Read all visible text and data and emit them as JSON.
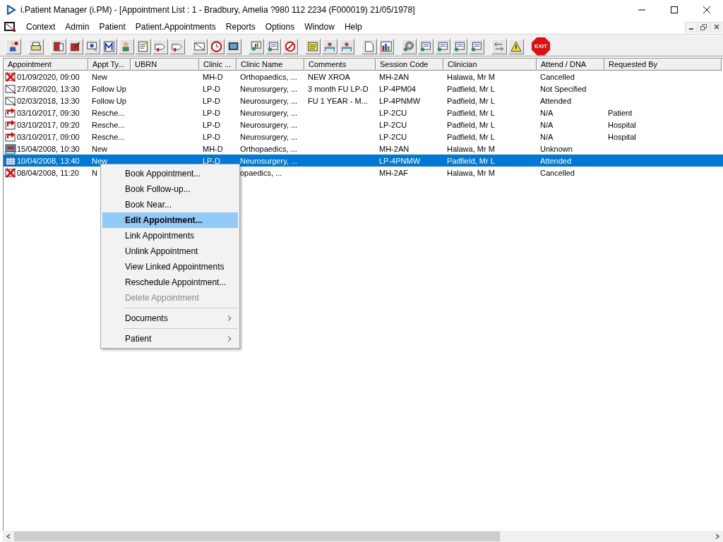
{
  "window": {
    "title": "i.Patient Manager (i.PM) - [Appointment List : 1 - Bradbury, Amelia ?980 112 2234 (F000019) 21/05/1978]"
  },
  "menu_bar": [
    "Context",
    "Admin",
    "Patient",
    "Patient.Appointments",
    "Reports",
    "Options",
    "Window",
    "Help"
  ],
  "toolbar": {
    "exit_label": "EXIT"
  },
  "table": {
    "columns": [
      "Appointment",
      "Appt Ty...",
      "UBRN",
      "Clinic ...",
      "Clinic Name",
      "Comments",
      "Session Code",
      "Clinician",
      "Attend / DNA",
      "Requested By"
    ],
    "rows": [
      {
        "kind": "cancelled",
        "selected": false,
        "cells": [
          "01/09/2020, 09:00",
          "New",
          "",
          "MH-D",
          "Orthopaedics, ...",
          "NEW XROA",
          "MH-2AN",
          "Halawa, Mr M",
          "Cancelled",
          ""
        ]
      },
      {
        "kind": "letter",
        "selected": false,
        "cells": [
          "27/08/2020, 13:30",
          "Follow Up",
          "",
          "LP-D",
          "Neurosurgery, ...",
          "3 month FU LP-D",
          "LP-4PM04",
          "Padfield, Mr L",
          "Not Specified",
          ""
        ]
      },
      {
        "kind": "letter",
        "selected": false,
        "cells": [
          "02/03/2018, 13:30",
          "Follow Up",
          "",
          "LP-D",
          "Neurosurgery, ...",
          "FU 1 YEAR - M...",
          "LP-4PNMW",
          "Padfield, Mr L",
          "Attended",
          ""
        ]
      },
      {
        "kind": "rescheduled",
        "selected": false,
        "cells": [
          "03/10/2017, 09:30",
          "Resche...",
          "",
          "LP-D",
          "Neurosurgery, ...",
          "",
          "LP-2CU",
          "Padfield, Mr L",
          "N/A",
          "Patient"
        ]
      },
      {
        "kind": "rescheduled",
        "selected": false,
        "cells": [
          "03/10/2017, 09:20",
          "Resche...",
          "",
          "LP-D",
          "Neurosurgery, ...",
          "",
          "LP-2CU",
          "Padfield, Mr L",
          "N/A",
          "Hospital"
        ]
      },
      {
        "kind": "rescheduled",
        "selected": false,
        "cells": [
          "03/10/2017, 09:00",
          "Resche...",
          "",
          "LP-D",
          "Neurosurgery, ...",
          "",
          "LP-2CU",
          "Padfield, Mr L",
          "N/A",
          "Hospital"
        ]
      },
      {
        "kind": "dna",
        "selected": false,
        "cells": [
          "15/04/2008, 10:30",
          "New",
          "",
          "MH-D",
          "Orthopaedics, ...",
          "",
          "MH-2AN",
          "Halawa, Mr M",
          "Unknown",
          ""
        ]
      },
      {
        "kind": "attended",
        "selected": true,
        "cells": [
          "10/04/2008, 13:40",
          "New",
          "",
          "LP-D",
          "Neurosurgery, ...",
          "",
          "LP-4PNMW",
          "Padfield, Mr L",
          "Attended",
          ""
        ]
      },
      {
        "kind": "cancelled",
        "selected": false,
        "cells": [
          "08/04/2008, 11:20",
          "N",
          "",
          "",
          "opaedics, ...",
          "",
          "MH-2AF",
          "Halawa, Mr M",
          "Cancelled",
          ""
        ]
      }
    ]
  },
  "context_menu": {
    "groups": [
      [
        {
          "label": "Book Appointment...",
          "selected": false,
          "disabled": false,
          "submenu": false
        },
        {
          "label": "Book Follow-up...",
          "selected": false,
          "disabled": false,
          "submenu": false
        },
        {
          "label": "Book Near...",
          "selected": false,
          "disabled": false,
          "submenu": false
        },
        {
          "label": "Edit Appointment...",
          "selected": true,
          "disabled": false,
          "submenu": false
        },
        {
          "label": "Link Appointments",
          "selected": false,
          "disabled": false,
          "submenu": false
        },
        {
          "label": "Unlink Appointment",
          "selected": false,
          "disabled": false,
          "submenu": false
        },
        {
          "label": "View Linked Appointments",
          "selected": false,
          "disabled": false,
          "submenu": false
        },
        {
          "label": "Reschedule Appointment...",
          "selected": false,
          "disabled": false,
          "submenu": false
        },
        {
          "label": "Delete Appointment",
          "selected": false,
          "disabled": true,
          "submenu": false
        }
      ],
      [
        {
          "label": "Documents",
          "selected": false,
          "disabled": false,
          "submenu": true
        }
      ],
      [
        {
          "label": "Patient",
          "selected": false,
          "disabled": false,
          "submenu": true
        }
      ]
    ]
  }
}
